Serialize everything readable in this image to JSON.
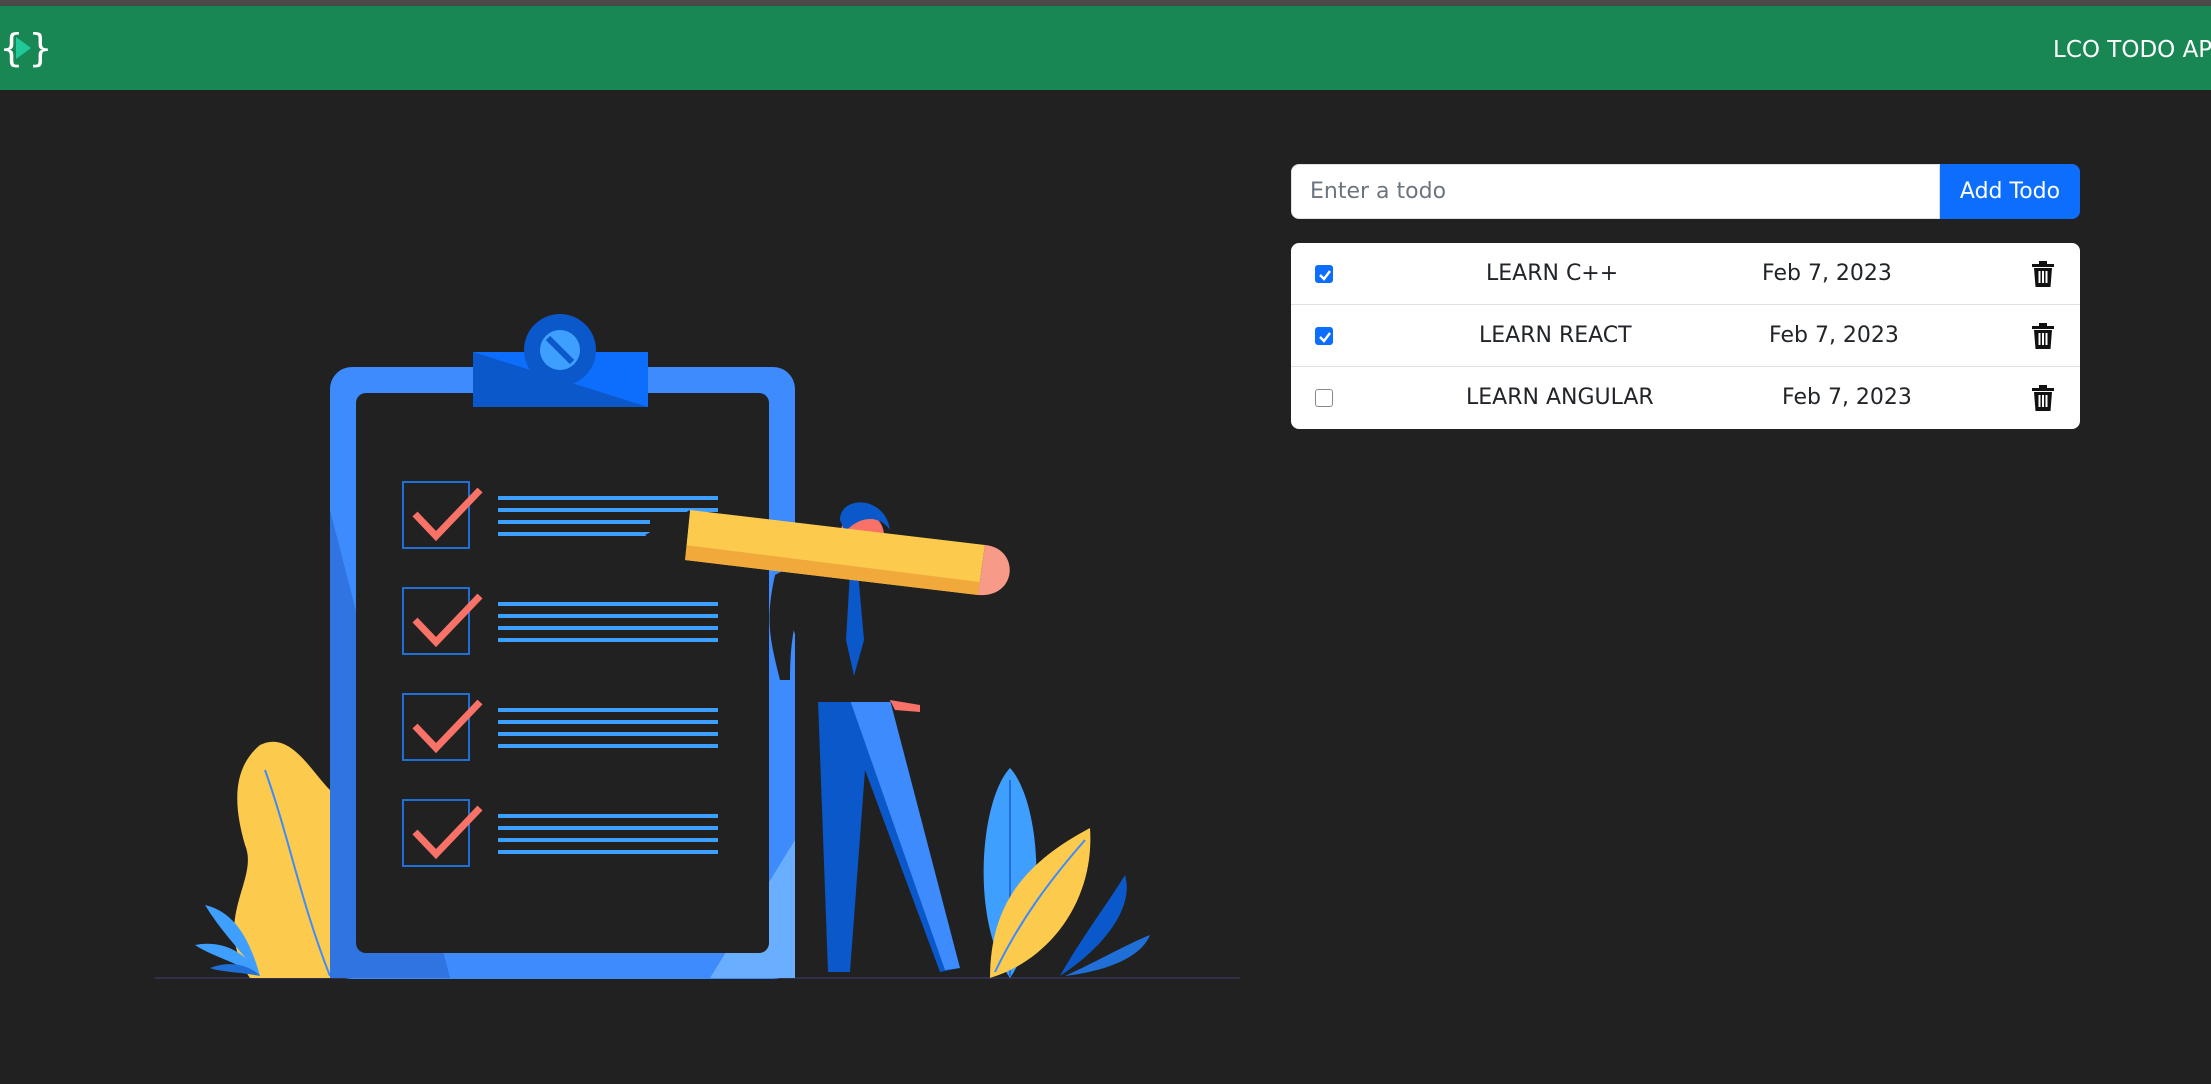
{
  "navbar": {
    "logo_icon": "code-braces-play-icon",
    "brand": "LCO TODO APP",
    "color": "#198754"
  },
  "form": {
    "placeholder": "Enter a todo",
    "value": "",
    "add_label": "Add Todo",
    "accent": "#0d6efd"
  },
  "todos": [
    {
      "checked": true,
      "title": "LEARN C++",
      "date": "Feb 7, 2023",
      "icon": "trash-icon"
    },
    {
      "checked": true,
      "title": "LEARN REACT",
      "date": "Feb 7, 2023",
      "icon": "trash-icon"
    },
    {
      "checked": false,
      "title": "LEARN ANGULAR",
      "date": "Feb 7, 2023",
      "icon": "trash-icon"
    }
  ],
  "illustration": {
    "name": "clipboard-checklist-illustration"
  }
}
